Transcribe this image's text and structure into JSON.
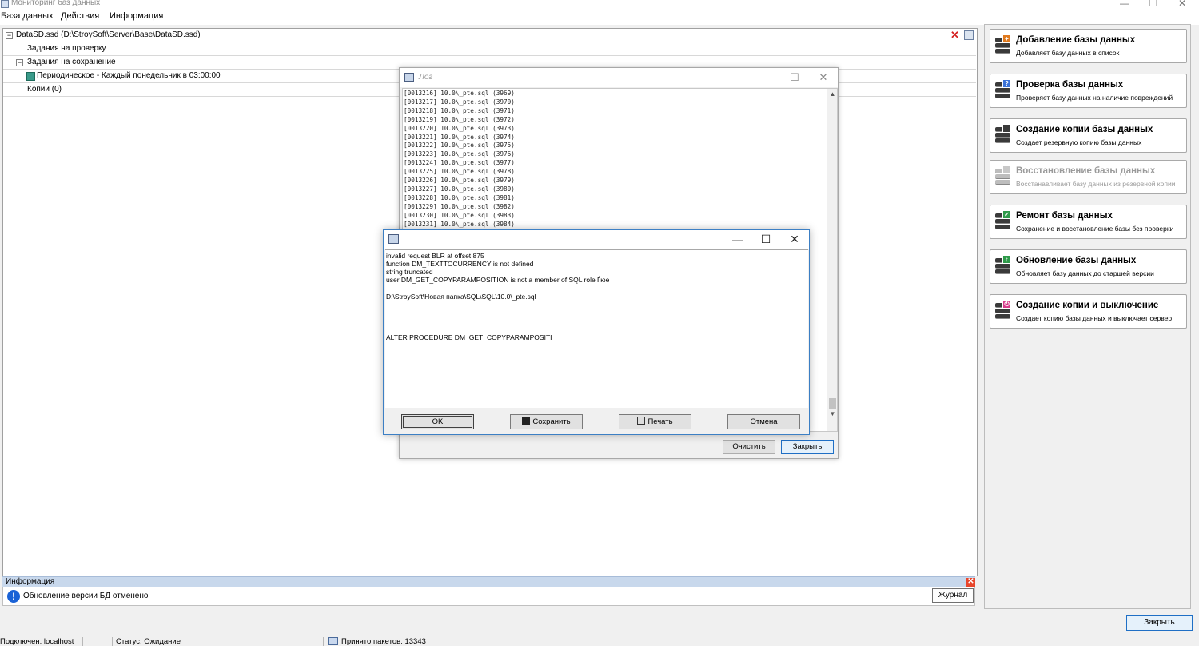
{
  "window": {
    "title": "Мониторинг баз данных",
    "minimize_glyph": "—",
    "restore_glyph": "❐",
    "close_glyph": "✕"
  },
  "menu": {
    "items": [
      "База данных",
      "Действия",
      "Информация"
    ]
  },
  "tree": {
    "root": "DataSD.ssd (D:\\StroySoft\\Server\\Base\\DataSD.ssd)",
    "rows": [
      {
        "label": "Задания на проверку"
      },
      {
        "label": "Задания на сохранение"
      },
      {
        "label": "Периодическое - Каждый понедельник в 03:00:00"
      },
      {
        "label": "Копии (0)"
      }
    ],
    "expander_minus": "−"
  },
  "info_panel": {
    "title": "Информация",
    "close_glyph": "✕",
    "icon_glyph": "!",
    "message": "Обновление версии БД отменено",
    "journal_button": "Журнал"
  },
  "actions": [
    {
      "title": "Добавление базы данных",
      "desc": "Добавляет базу данных в список",
      "badge_color": "#e07a1e",
      "badge_glyph": "+",
      "enabled": true
    },
    {
      "title": "Проверка базы данных",
      "desc": "Проверяет базу данных на наличие повреждений",
      "badge_color": "#3a72d8",
      "badge_glyph": "?",
      "enabled": true
    },
    {
      "title": "Создание копии базы данных",
      "desc": "Создает резервную копию базы данных",
      "badge_color": "#3a3a3a",
      "badge_glyph": "",
      "enabled": true
    },
    {
      "title": "Восстановление базы данных",
      "desc": "Восстанавливает базу данных из резервной копии",
      "badge_color": "#c8c8c8",
      "badge_glyph": "",
      "enabled": false
    },
    {
      "title": "Ремонт базы данных",
      "desc": "Сохранение и восстановление базы без проверки",
      "badge_color": "#2e9a4a",
      "badge_glyph": "✓",
      "enabled": true
    },
    {
      "title": "Обновление базы данных",
      "desc": "Обновляет базу данных до старшей версии",
      "badge_color": "#2e9a4a",
      "badge_glyph": "↑",
      "enabled": true
    },
    {
      "title": "Создание копии и выключение",
      "desc": "Создает копию базы данных и выключает сервер",
      "badge_color": "#d63a8a",
      "badge_glyph": "⏻",
      "enabled": true
    }
  ],
  "main_close_button": "Закрыть",
  "statusbar": {
    "connected": "Подключен: localhost",
    "status": "Статус: Ожидание",
    "packets": "Принято пакетов: 13343"
  },
  "log_window": {
    "title": "Лог",
    "lines": [
      "[0013216] 10.0\\_pte.sql (3969)",
      "[0013217] 10.0\\_pte.sql (3970)",
      "[0013218] 10.0\\_pte.sql (3971)",
      "[0013219] 10.0\\_pte.sql (3972)",
      "[0013220] 10.0\\_pte.sql (3973)",
      "[0013221] 10.0\\_pte.sql (3974)",
      "[0013222] 10.0\\_pte.sql (3975)",
      "[0013223] 10.0\\_pte.sql (3976)",
      "[0013224] 10.0\\_pte.sql (3977)",
      "[0013225] 10.0\\_pte.sql (3978)",
      "[0013226] 10.0\\_pte.sql (3979)",
      "[0013227] 10.0\\_pte.sql (3980)",
      "[0013228] 10.0\\_pte.sql (3981)",
      "[0013229] 10.0\\_pte.sql (3982)",
      "[0013230] 10.0\\_pte.sql (3983)",
      "[0013231] 10.0\\_pte.sql (3984)"
    ],
    "clear_button": "Очистить",
    "close_button": "Закрыть",
    "scroll_up": "▲",
    "scroll_down": "▼",
    "minimize_glyph": "—",
    "maximize_glyph": "☐",
    "close_glyph": "✕"
  },
  "error_dialog": {
    "lines": [
      "invalid request BLR at offset 875",
      "function DM_TEXTTOCURRENCY is not defined",
      "string truncated",
      "user DM_GET_COPYPARAMPOSITION is not a member of SQL role Ґюе",
      "D:\\StroySoft\\Новая папка\\SQL\\SQL\\10.0\\_pte.sql",
      "ALTER PROCEDURE DM_GET_COPYPARAMPOSITI"
    ],
    "buttons": {
      "ok": "OK",
      "save": "Сохранить",
      "print": "Печать",
      "cancel": "Отмена"
    },
    "minimize_glyph": "—",
    "maximize_glyph": "☐",
    "close_glyph": "✕"
  }
}
